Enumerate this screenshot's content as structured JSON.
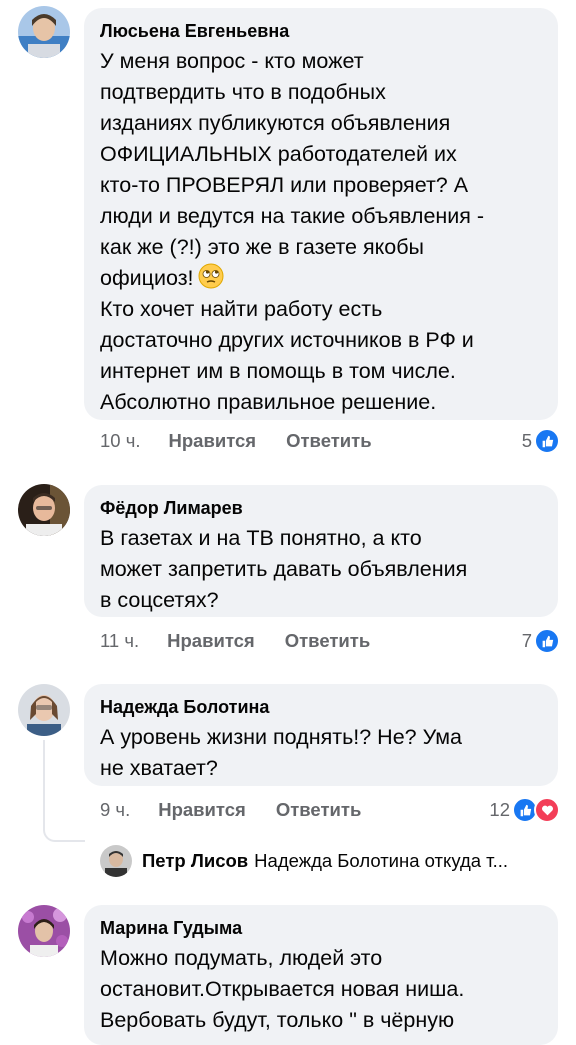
{
  "comments": [
    {
      "author": "Люсьена Евгеньевна",
      "text": "У меня вопрос - кто может\nподтвердить что в подобных\nизданиях публикуются объявления\nОФИЦИАЛЬНЫХ работодателей их\nкто-то ПРОВЕРЯЛ или проверяет? А\nлюди и ведутся на такие объявления -\nкак же (?!) это же в газете якобы\nофициоз!",
      "text2": "Кто хочет найти работу есть\nдостаточно других источников в РФ и\nинтернет им в помощь в том числе.\nАбсолютно правильное решение.",
      "emoji": "face-with-rolling-eyes",
      "time": "10 ч.",
      "like_label": "Нравится",
      "reply_label": "Ответить",
      "reactions": "5"
    },
    {
      "author": "Фёдор Лимарев",
      "text": "В газетах и на ТВ понятно, а кто\nможет запретить давать объявления\nв соцсетях?",
      "time": "11 ч.",
      "like_label": "Нравится",
      "reply_label": "Ответить",
      "reactions": "7"
    },
    {
      "author": "Надежда Болотина",
      "text": "А уровень жизни поднять!? Не? Ума\nне хватает?",
      "time": "9 ч.",
      "like_label": "Нравится",
      "reply_label": "Ответить",
      "reactions": "12"
    },
    {
      "author": "Марина Гудыма",
      "text": "Можно подумать, людей это\nостановит.Открывается новая ниша.\nВербовать будут, только \" в чёрную"
    }
  ],
  "reply_preview": {
    "author": "Петр Лисов",
    "text": "Надежда Болотина откуда т..."
  },
  "colors": {
    "bubble": "#f0f2f5",
    "meta": "#65676b",
    "like": "#1877f2",
    "love": "#f33e58"
  }
}
